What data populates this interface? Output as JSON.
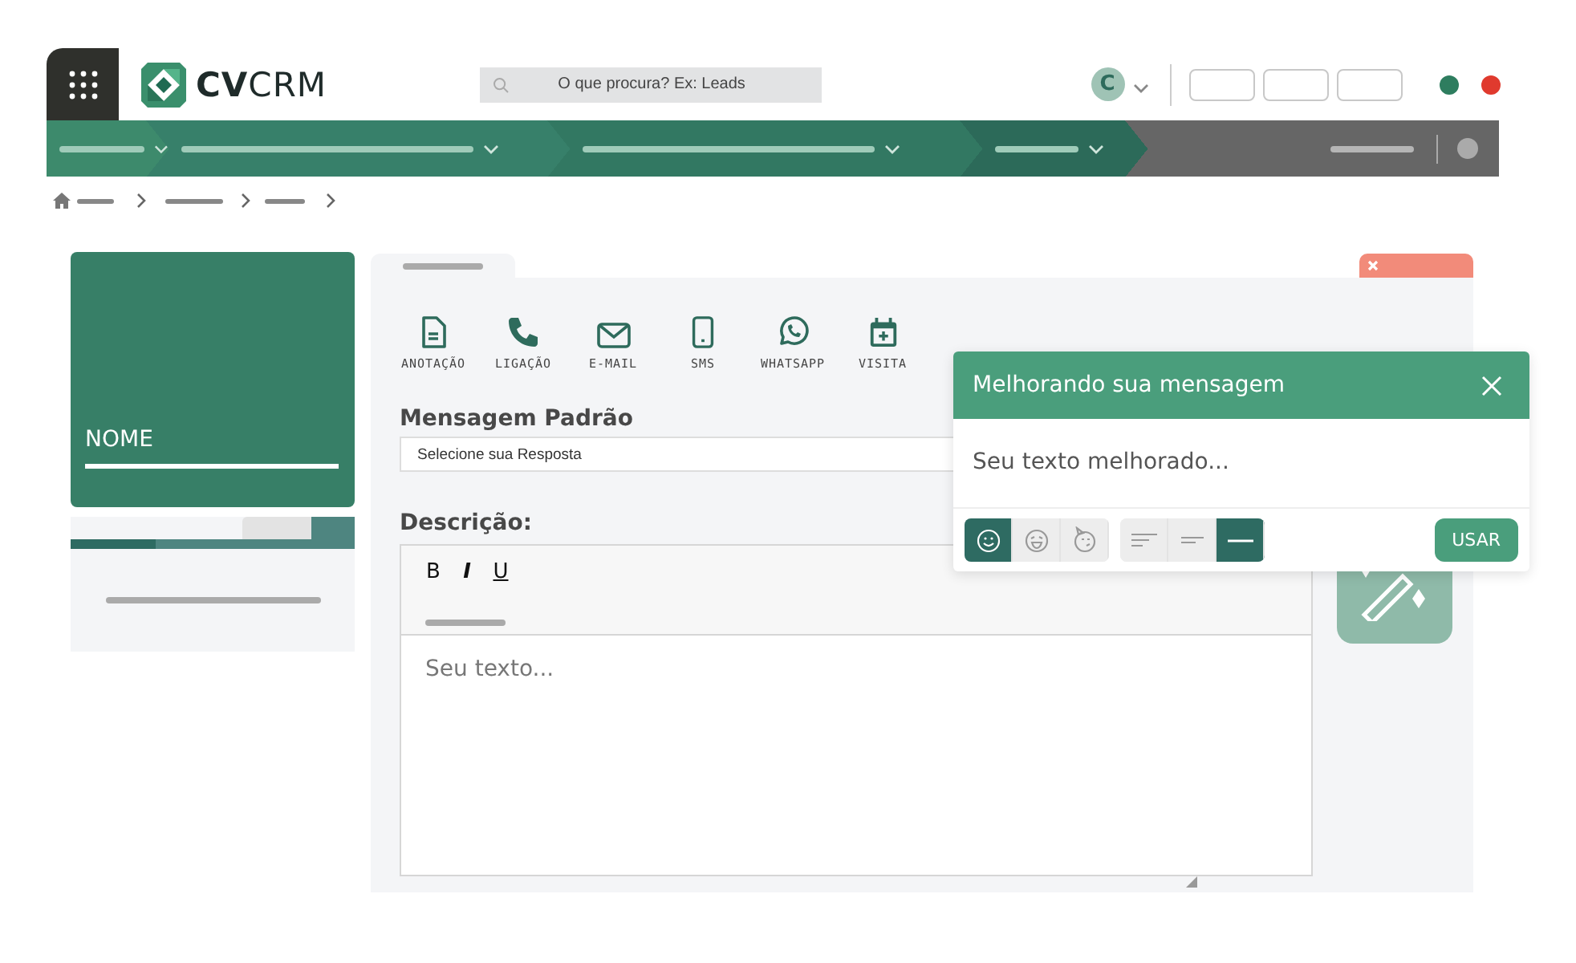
{
  "header": {
    "logo": "**CV**CRM",
    "search": {
      "placeholder": "O que procura? Ex: Leads"
    },
    "avatar": {
      "initial": "C"
    }
  },
  "profile_card": {
    "name": "NOME"
  },
  "actions": [
    {
      "kind": "note",
      "label": "ANOTAÇÃO"
    },
    {
      "kind": "call",
      "label": "LIGAÇÃO"
    },
    {
      "kind": "email",
      "label": "E-MAIL"
    },
    {
      "kind": "sms",
      "label": "SMS"
    },
    {
      "kind": "whatsapp",
      "label": "WHATSAPP"
    },
    {
      "kind": "visit",
      "label": "VISITA"
    }
  ],
  "compose": {
    "template": {
      "label": "Mensagem Padrão",
      "value": "Selecione sua Resposta"
    },
    "description": {
      "label": "Descrição:",
      "placeholder": "Seu texto..."
    },
    "format_buttons": [
      "B",
      "I",
      "U"
    ]
  },
  "improve_popup": {
    "title": "Melhorando sua mensagem",
    "placeholder": "Seu texto melhorado...",
    "tones": [
      {
        "kind": "smile",
        "selected": true
      },
      {
        "kind": "laugh",
        "selected": false
      },
      {
        "kind": "wink",
        "selected": false
      }
    ],
    "lengths": [
      {
        "kind": "long",
        "selected": false
      },
      {
        "kind": "medium",
        "selected": false
      },
      {
        "kind": "short",
        "selected": true
      }
    ],
    "use_button": "USAR"
  }
}
